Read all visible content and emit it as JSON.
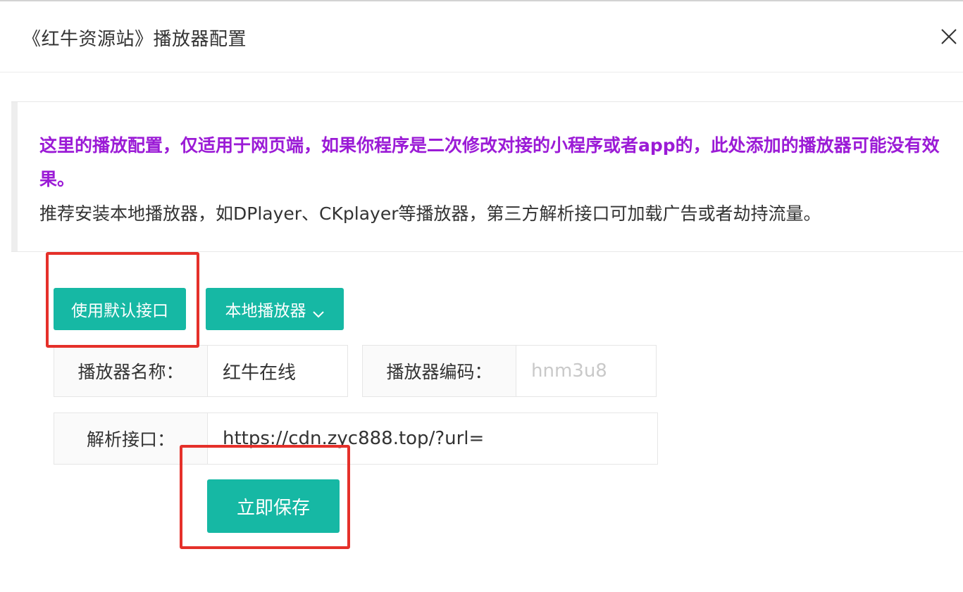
{
  "dialog": {
    "title": "《红牛资源站》播放器配置",
    "close_icon": "close-icon"
  },
  "notice": {
    "warning": "这里的播放配置，仅适用于网页端，如果你程序是二次修改对接的小程序或者app的，此处添加的播放器可能没有效果。",
    "tip": "推荐安装本地播放器，如DPlayer、CKplayer等播放器，第三方解析接口可加载广告或者劫持流量。",
    "warning_color": "#9b1bd6"
  },
  "actions": {
    "default_api_label": "使用默认接口",
    "local_player_label": "本地播放器",
    "local_player_icon": "chevron-down-icon",
    "save_label": "立即保存"
  },
  "form": {
    "player_name": {
      "label": "播放器名称：",
      "value": "红牛在线"
    },
    "player_code": {
      "label": "播放器编码：",
      "value": "",
      "placeholder": "hnm3u8"
    },
    "parse_api": {
      "label": "解析接口：",
      "value": "https://cdn.zyc888.top/?url="
    }
  },
  "colors": {
    "primary": "#16b8a4",
    "highlight": "#e5302a"
  }
}
